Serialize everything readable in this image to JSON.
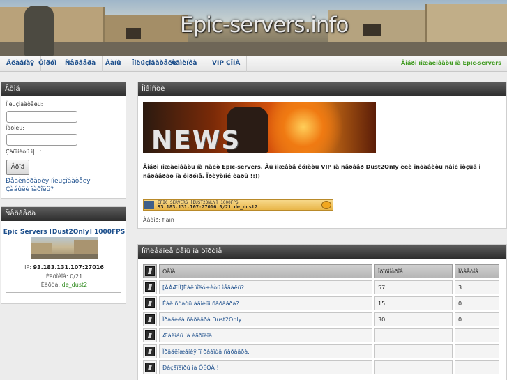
{
  "site": {
    "title": "Epic-servers.info"
  },
  "nav": {
    "items": [
      "Ãëàâíàÿ",
      "Ôîðóì",
      "Ñåðâåðà",
      "Áàíû",
      "Ïîëüçîâàòåëè",
      "Àäìèíêà",
      "VIP ÇÎÍÀ"
    ],
    "right_text": "Äîáðî ïîæàëîâàòü íà Epic-servers"
  },
  "login": {
    "title": "Âõîä",
    "username_label": "Ïîëüçîâàòåëü:",
    "password_label": "Ïàðîëü:",
    "remember_label": "Çàïîìíèòü ìåíÿ",
    "submit_label": "Âõîä",
    "register_link": "Ðåãèñòðàöèÿ ïîëüçîâàòåëÿ",
    "forgot_link": "Çàáûëè ïàðîëü?"
  },
  "servers": {
    "title": "Ñåðâåðà",
    "name": "Epic Servers [Dust2Only] 1000FPS",
    "ip_label": "IP:",
    "ip": "93.183.131.107:27016",
    "players_label": "Èãðîêîâ:",
    "players": "0/21",
    "map_label": "Êàðòà:",
    "map": "de_dust2"
  },
  "news": {
    "title": "Íîâîñòè",
    "image_word": "NEWS",
    "text": "Äîáðî ïîæàëîâàòü íà ñàéò Epic-servers. Âû ìîæåòå êóïèòü VIP íà ñåðâåð Dust2Only èëè îñòàâèòü ñâîé îòçûâ î ñåðâåðàõ íà ôîðóìå. Ïðèÿòíîé èãðû !:))",
    "banner_line1": "EPIC SERVERS [DUST2ONLY] 1000FPS",
    "banner_line2": "93.183.131.107:27016   0/21   de_dust2",
    "author_label": "Àâòîð:",
    "author": "flain"
  },
  "forum": {
    "title": "Ïîñëåäíèå òåìû íà ôîðóìå",
    "columns": [
      "Òåìà",
      "Ïðîñìîòðîâ",
      "Îòâåòîâ"
    ],
    "rows": [
      {
        "topic": "[ÂÀÆÍÎ]Êàê ïîëó÷èòü ìåäàëü?",
        "views": "57",
        "replies": "3"
      },
      {
        "topic": "Êàê ñòàòü àäìèíîì ñåðâåðà?",
        "views": "15",
        "replies": "0"
      },
      {
        "topic": "Ïðàâèëà ñåðâåðà Dust2Only",
        "views": "30",
        "replies": "0"
      },
      {
        "topic": "Æàëîáû íà èãðîêîâ",
        "views": "",
        "replies": ""
      },
      {
        "topic": "Ïðåäëîæåíèÿ ïî ðàáîòå ñåðâåðà.",
        "views": "",
        "replies": ""
      },
      {
        "topic": "Ðàçãîâîðû íà ÔËÓÄ !",
        "views": "",
        "replies": ""
      }
    ]
  }
}
